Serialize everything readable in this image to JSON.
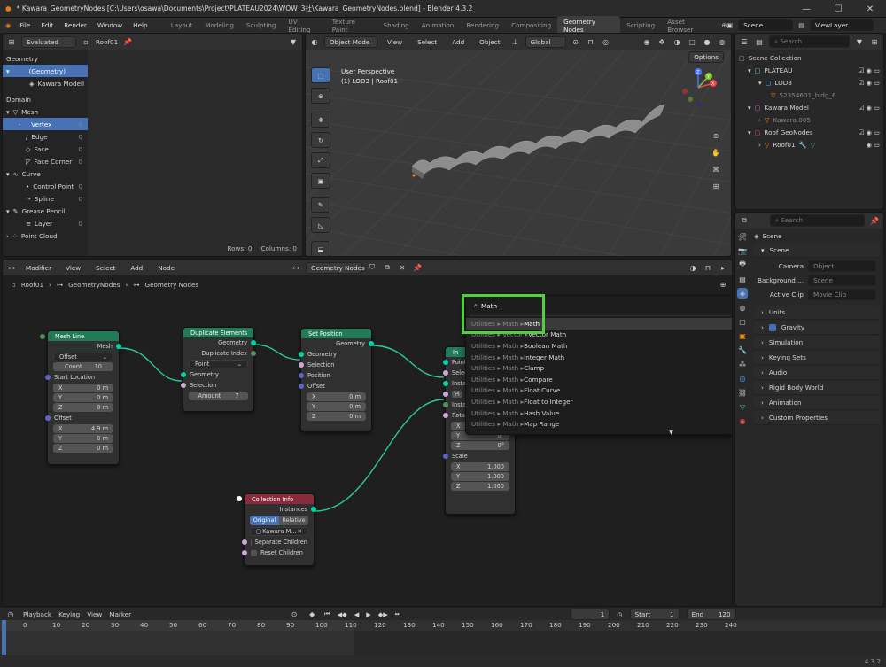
{
  "window": {
    "title": "* Kawara_GeometryNodes [C:\\Users\\osawa\\Documents\\Project\\PLATEAU2024\\WOW_3社\\Kawara_GeometryNodes.blend] - Blender 4.3.2",
    "minimize": "—",
    "maximize": "☐",
    "close": "✕"
  },
  "menu": [
    "File",
    "Edit",
    "Render",
    "Window",
    "Help"
  ],
  "workspaces": [
    "Layout",
    "Modeling",
    "Sculpting",
    "UV Editing",
    "Texture Paint",
    "Shading",
    "Animation",
    "Rendering",
    "Compositing",
    "Geometry Nodes",
    "Scripting",
    "Asset Browser"
  ],
  "scene": {
    "name": "Scene",
    "view_layer": "ViewLayer"
  },
  "spreadsheet": {
    "mode": "Evaluated",
    "object": "Roof01",
    "geometry_label": "Geometry",
    "tree": [
      {
        "label": "(Geometry)",
        "selected": true
      },
      {
        "label": "Kawara ModelI",
        "selected": false
      }
    ],
    "domain_label": "Domain",
    "mesh_label": "Mesh",
    "mesh_items": [
      {
        "label": "Vertex",
        "count": "0",
        "selected": true
      },
      {
        "label": "Edge",
        "count": "0"
      },
      {
        "label": "Face",
        "count": "0"
      },
      {
        "label": "Face Corner",
        "count": "0"
      }
    ],
    "curve_label": "Curve",
    "curve_items": [
      {
        "label": "Control Point",
        "count": "0"
      },
      {
        "label": "Spline",
        "count": "0"
      }
    ],
    "grease_label": "Grease Pencil",
    "grease_items": [
      {
        "label": "Layer",
        "count": "0"
      }
    ],
    "pointcloud_label": "Point Cloud",
    "rows": "Rows: 0",
    "columns": "Columns: 0"
  },
  "viewport": {
    "mode": "Object Mode",
    "menus": [
      "View",
      "Select",
      "Add",
      "Object"
    ],
    "orientation": "Global",
    "options": "Options",
    "perspective": "User Perspective",
    "info": "(1) LOD3 | Roof01",
    "axes": {
      "x": "X",
      "y": "Y",
      "z": "Z"
    }
  },
  "outliner": {
    "search_placeholder": "Search",
    "items": [
      {
        "label": "Scene Collection",
        "indent": 0
      },
      {
        "label": "PLATEAU",
        "indent": 1
      },
      {
        "label": "LOD3",
        "indent": 2
      },
      {
        "label": "52354601_bldg_6",
        "indent": 3
      },
      {
        "label": "Kawara Model",
        "indent": 1
      },
      {
        "label": "Kawara.005",
        "indent": 2
      },
      {
        "label": "Roof GeoNodes",
        "indent": 1
      },
      {
        "label": "Roof01",
        "indent": 2
      }
    ]
  },
  "properties": {
    "search_placeholder": "Search",
    "context": "Scene",
    "sections": {
      "scene": "Scene",
      "camera": "Camera",
      "camera_value": "Object",
      "background": "Background ...",
      "background_value": "Scene",
      "active_clip": "Active Clip",
      "active_clip_value": "Movie Clip"
    },
    "collapsed": [
      "Units",
      "Gravity",
      "Simulation",
      "Keying Sets",
      "Audio",
      "Rigid Body World",
      "Animation",
      "Custom Properties"
    ]
  },
  "node_editor": {
    "editor": "Modifier",
    "menus": [
      "View",
      "Select",
      "Add",
      "Node"
    ],
    "tree_name": "Geometry Nodes",
    "breadcrumb": [
      "Roof01",
      "GeometryNodes",
      "Geometry Nodes"
    ]
  },
  "nodes": {
    "mesh_line": {
      "title": "Mesh Line",
      "out": "Mesh",
      "mode": "Offset",
      "count_label": "Count",
      "count": "10",
      "start": "Start Location",
      "x": "X",
      "y": "Y",
      "z": "Z",
      "sx": "0 m",
      "sy": "0 m",
      "sz": "0 m",
      "offset": "Offset",
      "ox": "4.9 m",
      "oy": "0 m",
      "oz": "0 m"
    },
    "duplicate": {
      "title": "Duplicate Elements",
      "out1": "Geometry",
      "out2": "Duplicate Index",
      "domain": "Point",
      "in_geo": "Geometry",
      "in_sel": "Selection",
      "amount_label": "Amount",
      "amount": "7"
    },
    "setpos": {
      "title": "Set Position",
      "out": "Geometry",
      "in_geo": "Geometry",
      "in_sel": "Selection",
      "in_pos": "Position",
      "in_off": "Offset",
      "x": "X",
      "y": "Y",
      "z": "Z",
      "ox": "0 m",
      "oy": "0 m",
      "oz": "0 m"
    },
    "instance": {
      "title": "In",
      "in1": "Points",
      "in2": "Selec",
      "in3": "Insta",
      "in4": "Pi",
      "in5": "Insta",
      "in6": "Rotat",
      "x": "X",
      "y": "Y",
      "z": "Z",
      "rx": "0°",
      "ry": "0°",
      "rz": "0°",
      "scale": "Scale",
      "sx": "1.000",
      "sy": "1.000",
      "sz": "1.000"
    },
    "collection": {
      "title": "Collection Info",
      "out": "Instances",
      "original": "Original",
      "relative": "Relative",
      "coll": "Kawara M...",
      "sep": "Separate Children",
      "reset": "Reset Children"
    }
  },
  "search": {
    "query": "Math",
    "results": [
      {
        "path": "Utilities ▸ Math ▸ ",
        "name": "Math"
      },
      {
        "path": "Utilities ▸ Vector ▸ ",
        "name": "Vector Math"
      },
      {
        "path": "Utilities ▸ Math ▸ ",
        "name": "Boolean Math"
      },
      {
        "path": "Utilities ▸ Math ▸ ",
        "name": "Integer Math"
      },
      {
        "path": "Utilities ▸ Math ▸ ",
        "name": "Clamp"
      },
      {
        "path": "Utilities ▸ Math ▸ ",
        "name": "Compare"
      },
      {
        "path": "Utilities ▸ Math ▸ ",
        "name": "Float Curve"
      },
      {
        "path": "Utilities ▸ Math ▸ ",
        "name": "Float to Integer"
      },
      {
        "path": "Utilities ▸ Math ▸ ",
        "name": "Hash Value"
      },
      {
        "path": "Utilities ▸ Math ▸ ",
        "name": "Map Range"
      }
    ],
    "more": "▼",
    "highlight_color": "#4fd13b"
  },
  "timeline": {
    "playback": "Playback",
    "keying": "Keying",
    "view": "View",
    "marker": "Marker",
    "frame": "1",
    "start_label": "Start",
    "start": "1",
    "end_label": "End",
    "end": "120",
    "ticks": [
      "0",
      "10",
      "20",
      "30",
      "40",
      "50",
      "60",
      "70",
      "80",
      "90",
      "100",
      "110",
      "120",
      "130",
      "140",
      "150",
      "160",
      "170",
      "180",
      "190",
      "200",
      "210",
      "220",
      "230",
      "240"
    ]
  },
  "status": {
    "version": "4.3.2"
  }
}
